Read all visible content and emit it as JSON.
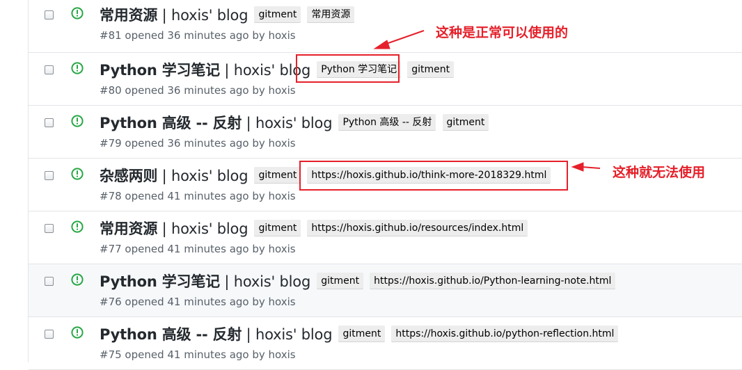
{
  "issues": [
    {
      "title_main": "常用资源",
      "title_rest": " | hoxis' blog",
      "labels": [
        "gitment",
        "常用资源"
      ],
      "meta": "#81 opened 36 minutes ago by hoxis"
    },
    {
      "title_main": "Python 学习笔记",
      "title_rest": " | hoxis' blog",
      "labels": [
        "Python 学习笔记",
        "gitment"
      ],
      "meta": "#80 opened 36 minutes ago by hoxis"
    },
    {
      "title_main": "Python 高级 -- 反射",
      "title_rest": " | hoxis' blog",
      "labels": [
        "Python 高级 -- 反射",
        "gitment"
      ],
      "meta": "#79 opened 36 minutes ago by hoxis"
    },
    {
      "title_main": "杂感两则",
      "title_rest": " | hoxis' blog",
      "labels": [
        "gitment",
        "https://hoxis.github.io/think-more-2018329.html"
      ],
      "meta": "#78 opened 41 minutes ago by hoxis"
    },
    {
      "title_main": "常用资源",
      "title_rest": " | hoxis' blog",
      "labels": [
        "gitment",
        "https://hoxis.github.io/resources/index.html"
      ],
      "meta": "#77 opened 41 minutes ago by hoxis"
    },
    {
      "title_main": "Python 学习笔记",
      "title_rest": " | hoxis' blog",
      "labels": [
        "gitment",
        "https://hoxis.github.io/Python-learning-note.html"
      ],
      "meta": "#76 opened 41 minutes ago by hoxis"
    },
    {
      "title_main": "Python 高级 -- 反射",
      "title_rest": " | hoxis' blog",
      "labels": [
        "gitment",
        "https://hoxis.github.io/python-reflection.html"
      ],
      "meta": "#75 opened 41 minutes ago by hoxis"
    }
  ],
  "annotations": {
    "works": "这种是正常可以使用的",
    "fails": "这种就无法使用"
  },
  "colors": {
    "open_icon": "#28a745",
    "annotation_red": "#e5202a",
    "label_bg": "#ededed",
    "row_highlight": "#f6f8fa"
  }
}
